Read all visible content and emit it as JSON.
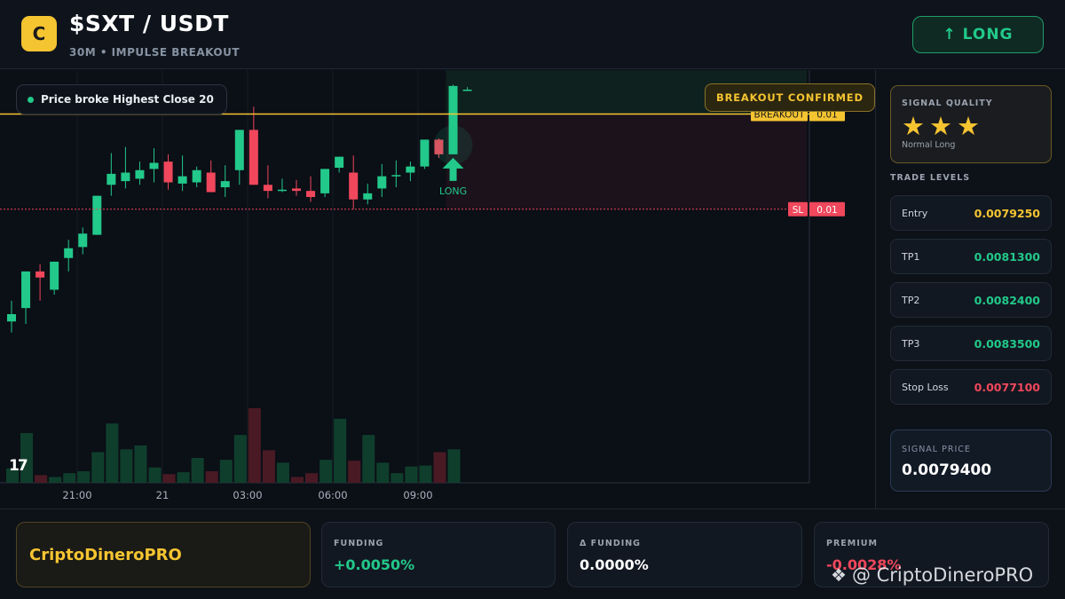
{
  "header": {
    "logo_letter": "C",
    "title": "$SXT / USDT",
    "subtitle": "30M • IMPULSE BREAKOUT",
    "long_button": "↑ LONG"
  },
  "chart": {
    "pill_text": "Price broke Highest Close 20",
    "confirm_badge": "BREAKOUT CONFIRMED",
    "breakout_label": "BREAKOUT",
    "breakout_value": "0.01",
    "top_value": "0.01",
    "sl_label": "SL",
    "sl_value": "0.01",
    "long_marker": "LONG",
    "tv_logo": "17",
    "time_labels": [
      "21:00",
      "21",
      "03:00",
      "06:00",
      "09:00"
    ],
    "colors": {
      "up": "#22c98a",
      "down": "#f0475c",
      "breakout": "#f5c431",
      "sl": "#f0475c"
    }
  },
  "chart_data": {
    "type": "candlestick",
    "x": [
      "21:00",
      "21",
      "03:00",
      "06:00",
      "09:00"
    ],
    "candles": [
      {
        "o": 0.4,
        "h": 2.1,
        "c": 1.0,
        "l": -0.5
      },
      {
        "o": 1.5,
        "h": 4.1,
        "c": 4.5,
        "l": 0.2
      },
      {
        "o": 4.5,
        "h": 5.1,
        "c": 4.0,
        "l": 2.1
      },
      {
        "o": 3.0,
        "h": 5.3,
        "c": 5.3,
        "l": 2.6
      },
      {
        "o": 5.6,
        "h": 7.1,
        "c": 6.4,
        "l": 4.5
      },
      {
        "o": 6.5,
        "h": 8.1,
        "c": 7.6,
        "l": 5.9
      },
      {
        "o": 7.5,
        "h": 9.7,
        "c": 10.7,
        "l": 7.5
      },
      {
        "o": 11.6,
        "h": 14.2,
        "c": 12.5,
        "l": 10.7
      },
      {
        "o": 11.9,
        "h": 14.7,
        "c": 12.6,
        "l": 11.3
      },
      {
        "o": 12.1,
        "h": 13.5,
        "c": 12.8,
        "l": 11.6
      },
      {
        "o": 12.9,
        "h": 14.6,
        "c": 13.4,
        "l": 11.8
      },
      {
        "o": 13.5,
        "h": 14.1,
        "c": 11.8,
        "l": 11.2
      },
      {
        "o": 11.7,
        "h": 14.0,
        "c": 12.3,
        "l": 11.1
      },
      {
        "o": 11.8,
        "h": 13.1,
        "c": 12.8,
        "l": 11.4
      },
      {
        "o": 12.6,
        "h": 13.6,
        "c": 11.0,
        "l": 11.0
      },
      {
        "o": 11.4,
        "h": 13.2,
        "c": 11.9,
        "l": 10.6
      },
      {
        "o": 12.8,
        "h": 15.9,
        "c": 16.1,
        "l": 11.6
      },
      {
        "o": 16.1,
        "h": 18.0,
        "c": 11.6,
        "l": 11.6
      },
      {
        "o": 11.6,
        "h": 13.2,
        "c": 11.1,
        "l": 10.5
      },
      {
        "o": 11.2,
        "h": 12.1,
        "c": 11.2,
        "l": 11.0
      },
      {
        "o": 11.3,
        "h": 12.0,
        "c": 11.1,
        "l": 10.7
      },
      {
        "o": 11.1,
        "h": 12.3,
        "c": 10.6,
        "l": 10.2
      },
      {
        "o": 10.9,
        "h": 12.8,
        "c": 12.9,
        "l": 10.6
      },
      {
        "o": 13.0,
        "h": 13.8,
        "c": 13.9,
        "l": 12.6
      },
      {
        "o": 12.6,
        "h": 14.0,
        "c": 10.4,
        "l": 9.6
      },
      {
        "o": 10.4,
        "h": 11.7,
        "c": 10.9,
        "l": 10.0
      },
      {
        "o": 11.3,
        "h": 13.3,
        "c": 12.3,
        "l": 10.6
      },
      {
        "o": 12.3,
        "h": 13.6,
        "c": 12.4,
        "l": 11.4
      },
      {
        "o": 12.6,
        "h": 13.5,
        "c": 13.1,
        "l": 11.9
      },
      {
        "o": 13.1,
        "h": 15.2,
        "c": 15.3,
        "l": 12.9
      },
      {
        "o": 15.3,
        "h": 15.4,
        "c": 14.1,
        "l": 13.8
      },
      {
        "o": 14.1,
        "h": 19.8,
        "c": 19.7,
        "l": 14.1
      },
      {
        "o": 19.4,
        "h": 19.6,
        "c": 19.4,
        "l": 19.3
      }
    ],
    "volumes": [
      1.5,
      5.2,
      0.8,
      0.6,
      1.0,
      1.2,
      3.2,
      6.2,
      3.5,
      3.9,
      1.6,
      0.9,
      1.1,
      2.6,
      1.2,
      2.4,
      5.0,
      7.8,
      3.4,
      2.1,
      0.6,
      1.0,
      2.4,
      6.7,
      2.3,
      5.0,
      2.1,
      1.0,
      1.7,
      1.8,
      3.2,
      3.5,
      0.0
    ],
    "breakout_level": 17.4,
    "stop_loss_level": 9.6,
    "entry_index": 31,
    "ylim": [
      -3,
      21
    ]
  },
  "sidebar": {
    "quality_label": "SIGNAL QUALITY",
    "stars": "★★★",
    "quality_sub": "Normal Long",
    "levels_title": "TRADE LEVELS",
    "levels": [
      {
        "name": "Entry",
        "value": "0.0079250",
        "color": "#f5c431"
      },
      {
        "name": "TP1",
        "value": "0.0081300",
        "color": "#22c98a"
      },
      {
        "name": "TP2",
        "value": "0.0082400",
        "color": "#22c98a"
      },
      {
        "name": "TP3",
        "value": "0.0083500",
        "color": "#22c98a"
      },
      {
        "name": "Stop Loss",
        "value": "0.0077100",
        "color": "#f0475c"
      }
    ],
    "signal_price_label": "SIGNAL PRICE",
    "signal_price": "0.0079400"
  },
  "footer": {
    "brand": "CriptoDineroPRO",
    "funding_label": "FUNDING",
    "funding_value": "+0.0050%",
    "dfunding_label": "Δ FUNDING",
    "dfunding_value": "0.0000%",
    "premium_label": "PREMIUM",
    "premium_value": "-0.0028%",
    "watermark": "@ CriptoDineroPRO"
  }
}
